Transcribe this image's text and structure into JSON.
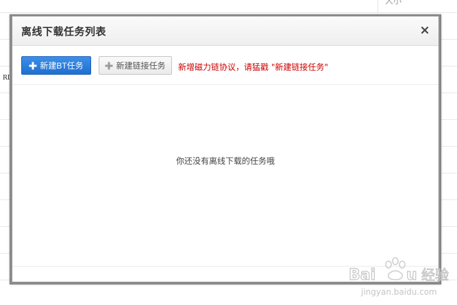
{
  "background": {
    "header_cell_text": "大小",
    "row_fragment_text": "RI"
  },
  "dialog": {
    "title": "离线下载任务列表",
    "close_label": "×",
    "toolbar": {
      "new_bt_task_label": "新建BT任务",
      "new_link_task_label": "新建链接任务",
      "notice_text": "新增磁力链协议，请猛戳 \"新建链接任务\""
    },
    "empty_message": "你还没有离线下载的任务哦"
  },
  "watermark": {
    "brand_text": "Bai",
    "brand_text_2": "u",
    "site_text": "经验",
    "url_text": "jingyan.baidu.com"
  },
  "colors": {
    "primary_button": "#2a7cdc",
    "notice_text": "#cc0000",
    "dialog_border": "#8f8f8f"
  }
}
